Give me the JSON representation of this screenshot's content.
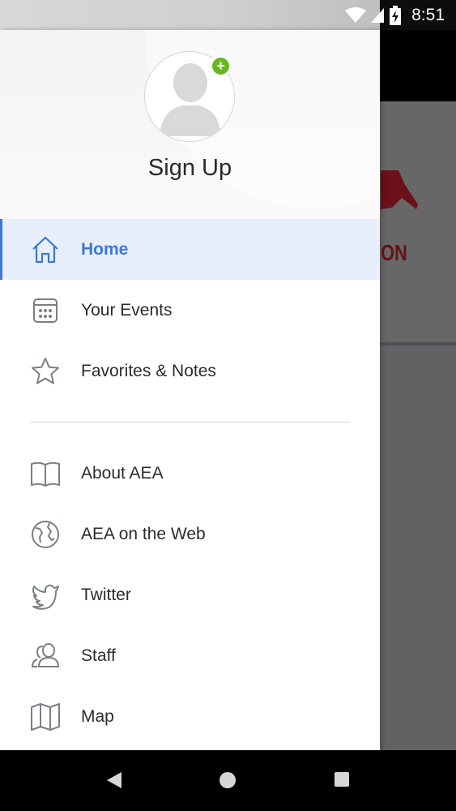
{
  "status_bar": {
    "time": "8:51",
    "icons": [
      "wifi-icon",
      "signal-icon",
      "battery-charging-icon"
    ]
  },
  "background": {
    "logo_fragment_text": "ION"
  },
  "drawer": {
    "header": {
      "signup_label": "Sign Up",
      "add_badge": "+",
      "avatar_icon": "user-silhouette-icon"
    },
    "items": [
      {
        "label": "Home",
        "icon": "home-icon",
        "active": true
      },
      {
        "label": "Your Events",
        "icon": "calendar-icon",
        "active": false
      },
      {
        "label": "Favorites & Notes",
        "icon": "star-icon",
        "active": false
      },
      {
        "label": "About AEA",
        "icon": "book-icon",
        "active": false
      },
      {
        "label": "AEA on the Web",
        "icon": "globe-icon",
        "active": false
      },
      {
        "label": "Twitter",
        "icon": "twitter-icon",
        "active": false
      },
      {
        "label": "Staff",
        "icon": "staff-icon",
        "active": false
      },
      {
        "label": "Map",
        "icon": "map-icon",
        "active": false
      }
    ]
  },
  "nav_bar": {
    "buttons": [
      "back-icon",
      "home-circle-icon",
      "recents-icon"
    ]
  },
  "colors": {
    "accent": "#3b78d8",
    "active_bg": "#e8effc",
    "badge_green": "#67b81e",
    "icon_gray": "#7a7f86",
    "logo_red": "#6b0f1a"
  }
}
